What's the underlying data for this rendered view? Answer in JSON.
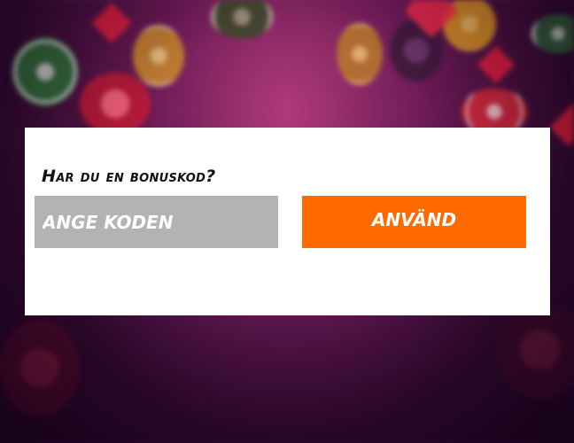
{
  "bonus": {
    "title": "Har du en bonuskod?",
    "input_placeholder": "ANGE KODEN",
    "input_value": "",
    "apply_label": "ANVÄND"
  },
  "colors": {
    "accent": "#ff6a00",
    "input_bg": "#b3b3b3",
    "panel_bg": "#ffffff",
    "background": "#6a1a55"
  },
  "background_items": [
    "green-poker-chip",
    "red-poker-chip",
    "gold-poker-chip",
    "red-diamond",
    "red-heart"
  ]
}
